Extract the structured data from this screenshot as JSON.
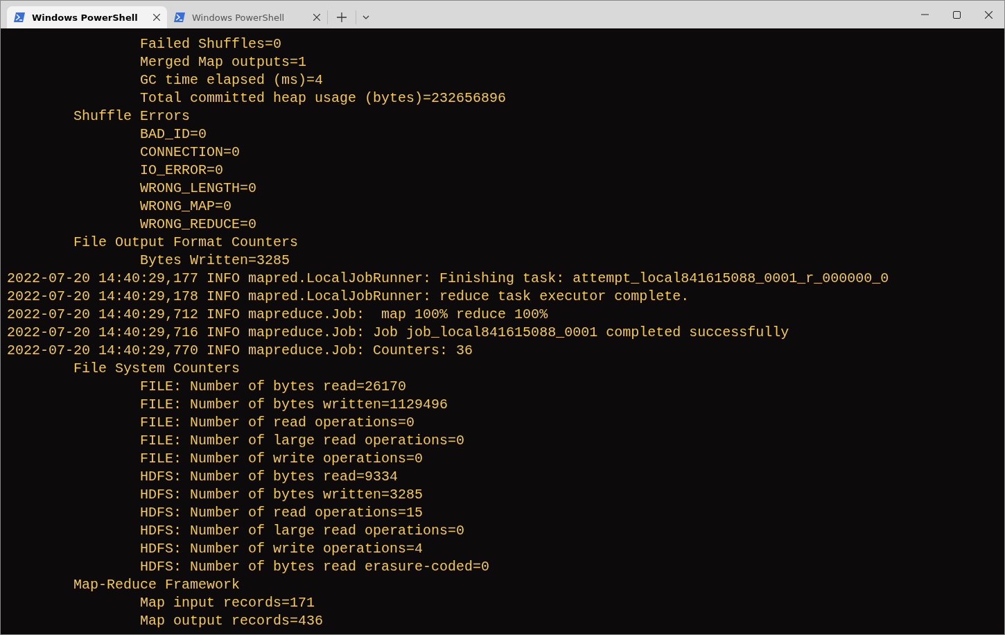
{
  "tabs": [
    {
      "label": "Windows PowerShell",
      "selected": true
    },
    {
      "label": "Windows PowerShell",
      "selected": false
    }
  ],
  "terminal": {
    "lines": [
      "                Failed Shuffles=0",
      "                Merged Map outputs=1",
      "                GC time elapsed (ms)=4",
      "                Total committed heap usage (bytes)=232656896",
      "        Shuffle Errors",
      "                BAD_ID=0",
      "                CONNECTION=0",
      "                IO_ERROR=0",
      "                WRONG_LENGTH=0",
      "                WRONG_MAP=0",
      "                WRONG_REDUCE=0",
      "        File Output Format Counters",
      "                Bytes Written=3285",
      "2022-07-20 14:40:29,177 INFO mapred.LocalJobRunner: Finishing task: attempt_local841615088_0001_r_000000_0",
      "2022-07-20 14:40:29,178 INFO mapred.LocalJobRunner: reduce task executor complete.",
      "2022-07-20 14:40:29,712 INFO mapreduce.Job:  map 100% reduce 100%",
      "2022-07-20 14:40:29,716 INFO mapreduce.Job: Job job_local841615088_0001 completed successfully",
      "2022-07-20 14:40:29,770 INFO mapreduce.Job: Counters: 36",
      "        File System Counters",
      "                FILE: Number of bytes read=26170",
      "                FILE: Number of bytes written=1129496",
      "                FILE: Number of read operations=0",
      "                FILE: Number of large read operations=0",
      "                FILE: Number of write operations=0",
      "                HDFS: Number of bytes read=9334",
      "                HDFS: Number of bytes written=3285",
      "                HDFS: Number of read operations=15",
      "                HDFS: Number of large read operations=0",
      "                HDFS: Number of write operations=4",
      "                HDFS: Number of bytes read erasure-coded=0",
      "        Map-Reduce Framework",
      "                Map input records=171",
      "                Map output records=436"
    ]
  }
}
